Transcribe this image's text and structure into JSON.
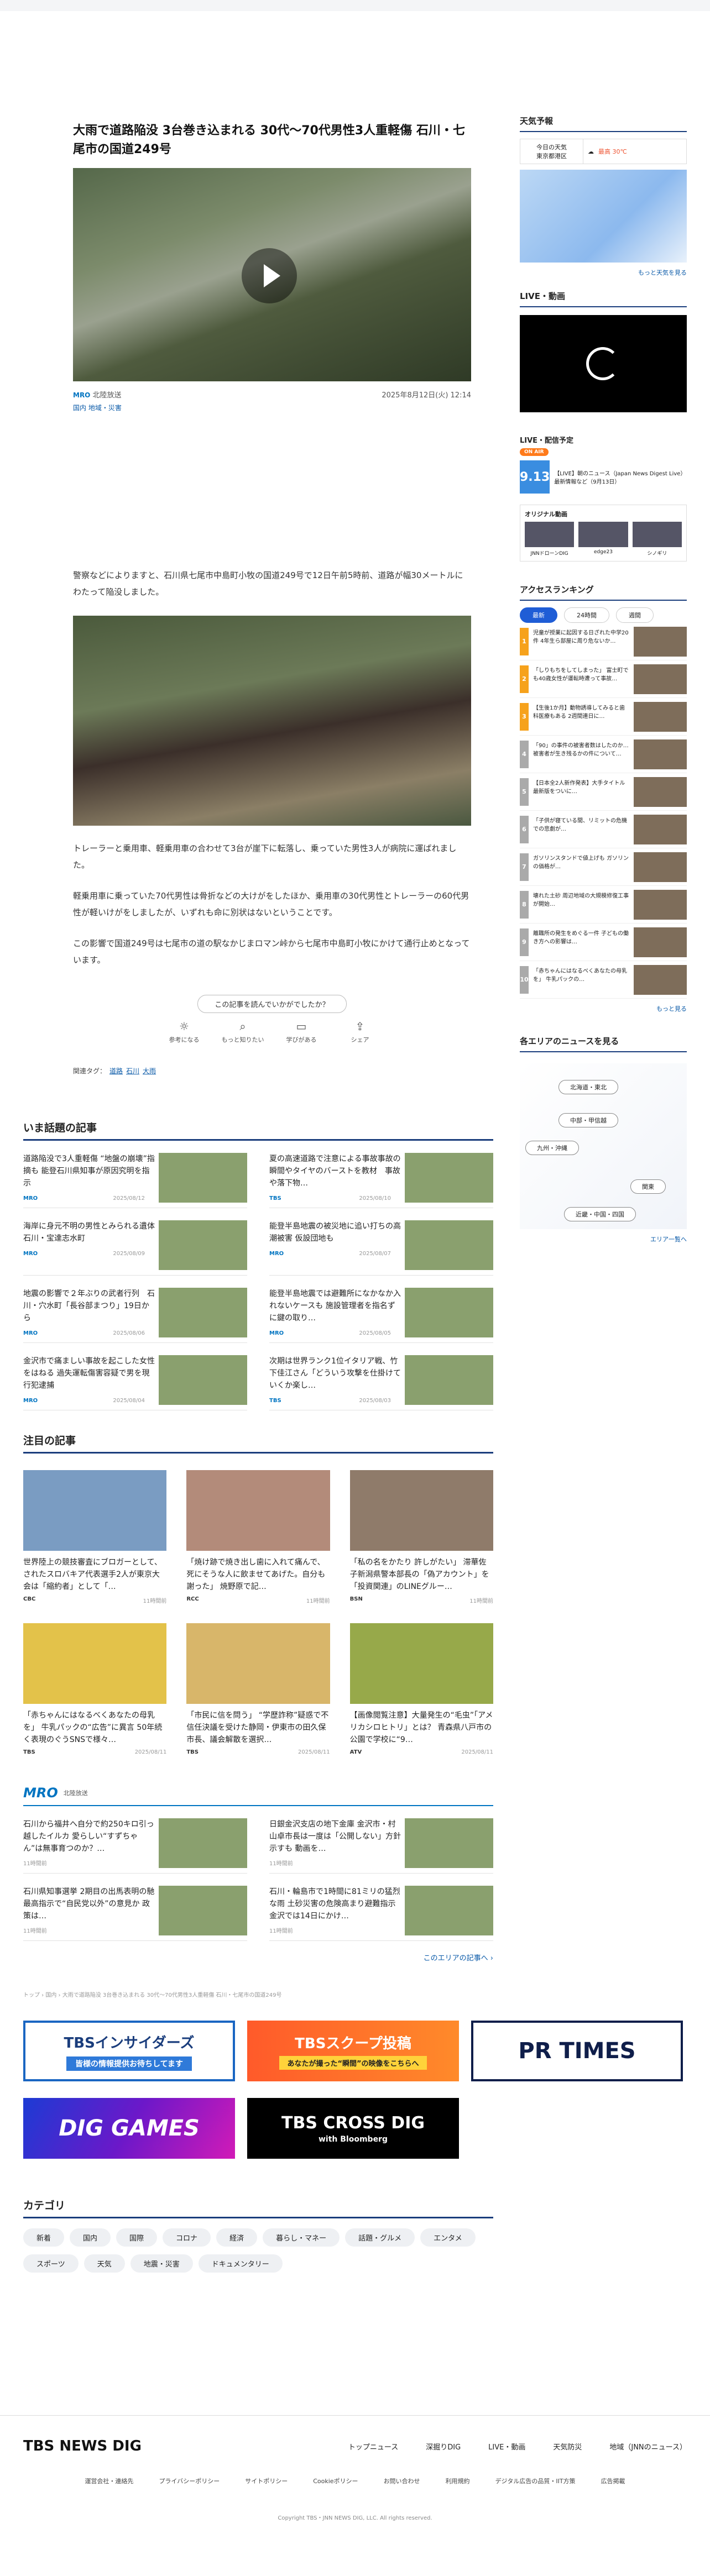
{
  "article": {
    "title": "大雨で道路陥没 3台巻き込まれる 30代〜70代男性3人重軽傷 石川・七尾市の国道249号",
    "source": "北陸放送",
    "source_logo": "MRO",
    "date": "2025年8月12日(火) 12:14",
    "categories": "国内  地域・災害",
    "p1": "警察などによりますと、石川県七尾市中島町小牧の国道249号で12日午前5時前、道路が幅30メートルにわたって陥没しました。",
    "p2": "トレーラーと乗用車、軽乗用車の合わせて3台が崖下に転落し、乗っていた男性3人が病院に運ばれました。",
    "p3": "軽乗用車に乗っていた70代男性は骨折などの大けがをしたほか、乗用車の30代男性とトレーラーの60代男性が軽いけがをしましたが、いずれも命に別状はないということです。",
    "p4": "この影響で国道249号は七尾市の道の駅なかじまロマン峠から七尾市中島町小牧にかけて通行止めとなっています。",
    "feedback_q": "この記事を読んでいかがでしたか？",
    "fb": [
      "参考になる",
      "もっと知りたい",
      "学びがある",
      "シェア"
    ],
    "tags_label": "関連タグ：",
    "tags": [
      "道路",
      "石川",
      "大雨"
    ]
  },
  "trending": {
    "title": "いま話題の記事",
    "items": [
      {
        "text": "道路陥没で3人重軽傷 “地盤の崩壊”指摘も 能登石川県知事が原因究明を指示",
        "src": "MRO",
        "date": "2025/08/12"
      },
      {
        "text": "夏の高速道路で注意による事故事故の瞬間やタイヤのバーストを教材　事故や落下物…",
        "src": "TBS",
        "date": "2025/08/10"
      },
      {
        "text": "海岸に身元不明の男性とみられる遺体 石川・宝達志水町",
        "src": "MRO",
        "date": "2025/08/09"
      },
      {
        "text": "能登半島地震の被災地に追い打ちの高潮被害 仮設団地も",
        "src": "MRO",
        "date": "2025/08/07"
      },
      {
        "text": "地震の影響で２年ぶりの武者行列　石川・穴水町「長谷部まつり」19日から",
        "src": "MRO",
        "date": "2025/08/06"
      },
      {
        "text": "能登半島地震では避難所になかなか入れないケースも 施設管理者を指名ずに鍵の取り…",
        "src": "MRO",
        "date": "2025/08/05"
      },
      {
        "text": "金沢市で痛ましい事故を起こした女性をはねる 過失運転傷害容疑で男を現行犯逮捕",
        "src": "MRO",
        "date": "2025/08/04"
      },
      {
        "text": "次期は世界ランク1位イタリア戦、竹下佳江さん「どういう攻撃を仕掛けていくか楽し…",
        "src": "TBS",
        "date": "2025/08/03"
      }
    ]
  },
  "featured": {
    "title": "注目の記事",
    "items": [
      {
        "text": "世界陸上の競技審査にブロガーとして、されたスロバキア代表選手2人が東京大会は「縮約者」として「…",
        "src": "CBC",
        "date": "11時間前"
      },
      {
        "text": "「焼け跡で焼き出し歯に入れて痛んで、死にそうな人に飲ませてあげた。自分も謝った」 焼野原で記…",
        "src": "RCC",
        "date": "11時間前"
      },
      {
        "text": "「私の名をかたり 許しがたい」 滞華佐子新潟県警本部長の「偽アカウント」を「投資関連」のLINEグルー…",
        "src": "BSN",
        "date": "11時間前"
      },
      {
        "text": "「赤ちゃんにはなるべくあなたの母乳を」 牛乳パックの“広告”に異言 50年続く表現のぐうSNSで様々…",
        "src": "TBS",
        "date": "2025/08/11"
      },
      {
        "text": "「市民に信を問う」 “学歴詐称”疑惑で不信任決議を受けた静岡・伊東市の田久保市長、議会解散を選択…",
        "src": "TBS",
        "date": "2025/08/11"
      },
      {
        "text": "【画像閲覧注意】大量発生の“毛虫”「アメリカシロヒトリ」とは？ 青森県八戸市の公園で学校に“9…",
        "src": "ATV",
        "date": "2025/08/11"
      }
    ]
  },
  "mro": {
    "logo": "MRO",
    "sub": "北陸放送",
    "items": [
      {
        "text": "石川から福井へ自分で約250キロ引っ越したイルカ 愛らしい“すずちゃん”は無事育つのか？…",
        "date": "11時間前"
      },
      {
        "text": "日銀金沢支店の地下金庫 金沢市・村山卓市長は一度は「公開しない」方針示すも 動画を…",
        "date": "11時間前"
      },
      {
        "text": "石川県知事選挙 2期目の出馬表明の馳 最高指示で“自民党以外”の意見か 政策は…",
        "date": "11時間前"
      },
      {
        "text": "石川・輪島市で1時間に81ミリの猛烈な雨 土砂災害の危険高まり避難指示 金沢では14日にかけ…",
        "date": "11時間前"
      }
    ],
    "more": "このエリアの記事へ ›"
  },
  "breadcrumb": "トップ › 国内 › 大雨で道路陥没 3台巻き込まれる 30代〜70代男性3人重軽傷 石川・七尾市の国道249号",
  "banners": {
    "b1": "TBSインサイダーズ",
    "b1_sub": "皆様の情報提供お待ちしてます",
    "b2": "TBSスクープ投稿",
    "b2_sub": "あなたが撮った“瞬間”の映像をこちらへ",
    "b3": "PR TIMES",
    "b4": "DIG GAMES",
    "b5": "TBS CROSS DIG",
    "b5_sub": "with Bloomberg"
  },
  "categories": {
    "title": "カテゴリ",
    "items": [
      "新着",
      "国内",
      "国際",
      "コロナ",
      "経済",
      "暮らし・マネー",
      "話題・グルメ",
      "エンタメ",
      "スポーツ",
      "天気",
      "地震・災害",
      "ドキュメンタリー"
    ]
  },
  "sidebar": {
    "weather_title": "天気予報",
    "wx_today": "今日の天気",
    "wx_pref": "東京都港区",
    "wx_max": "最高 30℃",
    "wx_more": "もっと天気を見る",
    "live_title": "LIVE・動画",
    "sched_title": "LIVE・配信予定",
    "onair": "ON AIR",
    "sched_date": "9.13",
    "sched_desc": "【LIVE】朝のニュース（Japan News Digest Live）最新情報など（9月13日）",
    "orig_title": "オリジナル動画",
    "orig": [
      "JNNドローンDIG",
      "edge23",
      "シノギリ"
    ],
    "rank_title": "アクセスランキング",
    "rank_tabs": [
      "最新",
      "24時間",
      "週間"
    ],
    "ranks": [
      "児童が授業に起因する日ざれた中学20件 4年生ら部屋に周り危ないか…",
      "「しりもちをしてしまった」 富士町でも40歳女性が運転時遭って事故…",
      "【生後1か月】動物誘導してみると歯科医療もある 2週間連日に…",
      "「90」の事件の被害者数はしたのか…被害者が生き残るかの件について…",
      "【日本全2人新作発表】大手タイトル最新版をついに…",
      "「子供が寝ている間、リミットの危機での悲劇が…",
      "ガソリンスタンドで値上げも ガソリンの価格が…",
      "壊れた土砂 周辺地域の大規模修復工事が開始…",
      "離職所の発生をめぐる一件 子どもの働き方への影響は…",
      "「赤ちゃんにはなるべくあなたの母乳を」 牛乳パックの…"
    ],
    "rank_more": "もっと見る",
    "area_title": "各エリアのニュースを見る",
    "areas": [
      "北海道・東北",
      "中部・甲信越",
      "九州・沖縄",
      "関東",
      "近畿・中国・四国"
    ],
    "area_more": "エリア一覧へ"
  },
  "footer": {
    "logo": "TBS NEWS DIG",
    "nav": [
      "トップニュース",
      "深掘りDIG",
      "LIVE・動画",
      "天気防災",
      "地域（JNNのニュース）"
    ],
    "links": [
      "運営会社・連絡先",
      "プライバシーポリシー",
      "サイトポリシー",
      "Cookieポリシー",
      "お問い合わせ",
      "利用規約",
      "デジタル広告の品質・IIT方策",
      "広告掲載"
    ],
    "copy": "Copyright TBS・JNN NEWS DIG, LLC. All rights reserved."
  }
}
